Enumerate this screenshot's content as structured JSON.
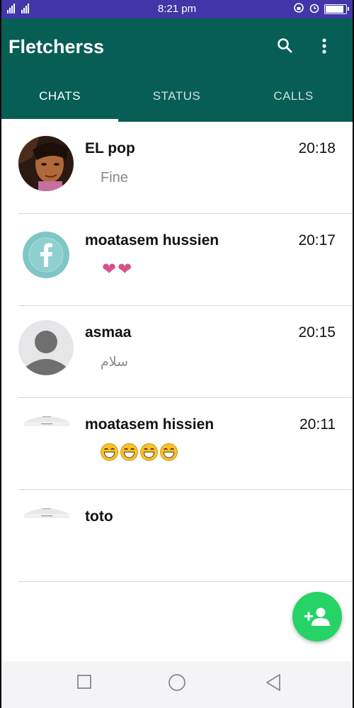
{
  "status_bar": {
    "signal": "⁴ᴳ⁴ᴳ",
    "time": "8:21 pm",
    "battery_level": 0.95
  },
  "app": {
    "title": "Fletcherss",
    "icons": [
      "search-icon",
      "more-vert-icon"
    ]
  },
  "tabs": [
    {
      "label": "CHATS",
      "active": true
    },
    {
      "label": "STATUS",
      "active": false
    },
    {
      "label": "CALLS",
      "active": false
    }
  ],
  "chats": [
    {
      "name": "EL pop",
      "time": "20:18",
      "message": "Fine",
      "avatar": "photo-avatar"
    },
    {
      "name": "moatasem hussien",
      "time": "20:17",
      "message": "❤❤",
      "avatar": "facebook-avatar"
    },
    {
      "name": "asmaa",
      "time": "20:15",
      "message": "سلام",
      "avatar": "default-user-avatar"
    },
    {
      "name": "moatasem hissien",
      "time": "20:11",
      "message_emoji_count": 4,
      "avatar": "screenshot-avatar"
    },
    {
      "name": "toto",
      "time": "",
      "message": "",
      "avatar": "screenshot-avatar"
    }
  ],
  "fab": {
    "icon": "add-contact-icon"
  },
  "colors": {
    "status_bar": "#4236a8",
    "app_bar": "#075e54",
    "fab": "#25d366",
    "heart": "#d6518a"
  },
  "nav_icons": [
    "recents-square-icon",
    "home-circle-icon",
    "back-triangle-icon"
  ]
}
